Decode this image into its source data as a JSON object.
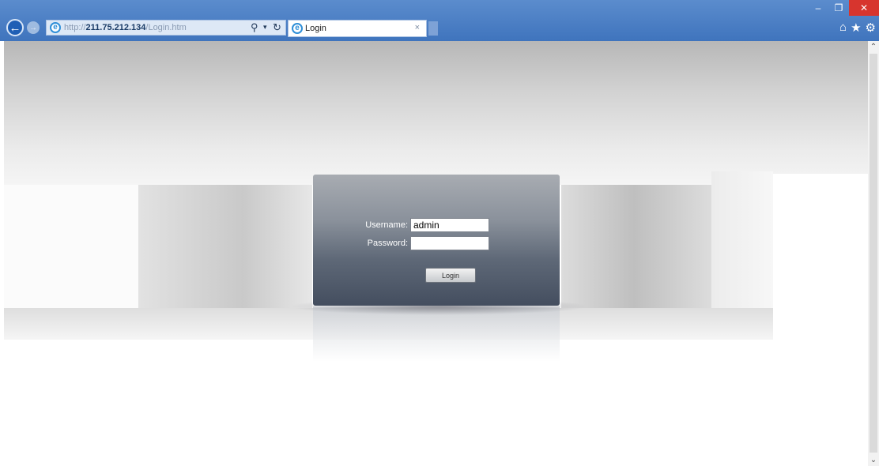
{
  "browser": {
    "url_scheme": "http://",
    "url_host": "211.75.212.134",
    "url_path": "/Login.htm",
    "tab_title": "Login",
    "tab_close": "×",
    "window_controls": {
      "minimize": "–",
      "restore": "❐",
      "close": "✕"
    },
    "icons": {
      "back": "back-arrow-icon",
      "forward": "forward-arrow-icon",
      "search": "search-icon",
      "refresh": "refresh-icon",
      "home": "home-icon",
      "favorites": "star-icon",
      "settings": "gear-icon"
    },
    "accent_color": "#3f74bd"
  },
  "login": {
    "username_label": "Username:",
    "username_value": "admin",
    "password_label": "Password:",
    "password_value": "",
    "button_label": "Login"
  }
}
